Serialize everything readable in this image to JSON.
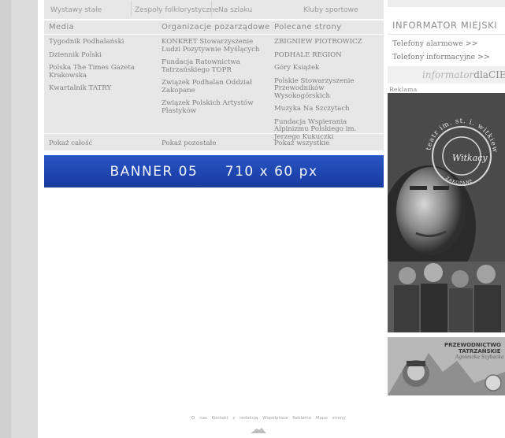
{
  "top_tabs": [
    "Wystawy stałe",
    "Zespoły folklorystyczne",
    "Na szlaku",
    "Kluby sportowe"
  ],
  "columns": {
    "media": {
      "heading": "Media",
      "items": [
        "Tygodnik Podhalański",
        "Dziennik Polski",
        "Polska The Times Gazeta Krakowska",
        "Kwartalnik TATRY"
      ],
      "more": "Pokaż całość"
    },
    "ngo": {
      "heading": "Organizacje pozarządowe",
      "items": [
        "KONKRET Stowarzyszenie Ludzi Pozytywnie Myślących",
        "Fundacja Ratownictwa Tatrzańskiego TOPR",
        "Związek Podhalan Oddział Zakopane",
        "Związek Polskich Artystów Plastyków"
      ],
      "more": "Pokaż pozostałe"
    },
    "recommended": {
      "heading": "Polecane strony",
      "items": [
        "ZBIGNIEW PIOTROWICZ",
        "PODHALE REGION",
        "Góry Książek",
        "Polskie Stowarzyszenie Przewodników Wysokogórskich",
        "Muzyka Na Szczytach",
        "Fundacja Wspierania Alpinizmu Polskiego im. Jerzego Kukuczki"
      ],
      "more": "Pokaż wszystkie"
    }
  },
  "banner": {
    "text": "BANNER 05     710 x 60 px"
  },
  "sidebar": {
    "title": "INFORMATOR MIEJSKI",
    "links": [
      "Telefony alarmowe >>",
      "Telefony informacyjne >>"
    ],
    "logo_left": "informator",
    "logo_right": "dlaCIEBIE",
    "ad_label": "Reklama",
    "ad1": {
      "ring_top": "teatr im. st. i. witkiewicza",
      "ring_bottom": "ZAKOPANE",
      "logo": "Witkacy"
    },
    "ad2": {
      "line1": "PRZEWODNICTWO",
      "line2": "TATRZAŃSKIE",
      "line3": "Agnieszka Szybacka"
    }
  },
  "footer": {
    "links": [
      "O nas",
      "Kontakt z redakcją",
      "Współpraca",
      "Reklama",
      "Mapa strony"
    ]
  },
  "colors": {
    "banner": "#1f45b0",
    "panel": "#e7e7e7",
    "background": "#dcdcdc"
  }
}
